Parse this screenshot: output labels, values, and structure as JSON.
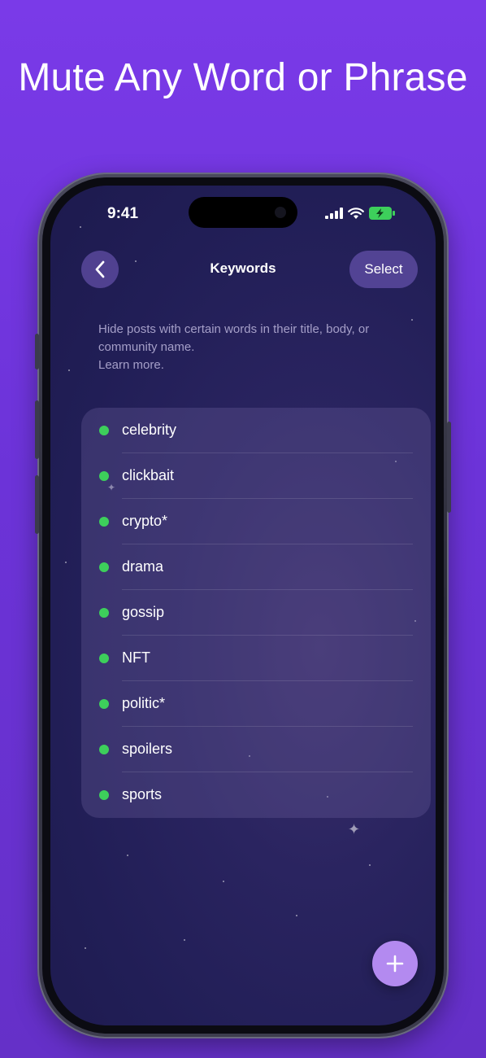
{
  "headline": "Mute Any Word or Phrase",
  "status_bar": {
    "time": "9:41",
    "icons": [
      "signal-icon",
      "wifi-icon",
      "battery-charging-icon"
    ]
  },
  "nav": {
    "title": "Keywords",
    "back_icon": "chevron-left-icon",
    "select_label": "Select"
  },
  "description": {
    "text": "Hide posts with certain words in their title, body, or community name.",
    "link": "Learn more."
  },
  "keywords": [
    {
      "label": "celebrity",
      "active": true
    },
    {
      "label": "clickbait",
      "active": true
    },
    {
      "label": "crypto*",
      "active": true
    },
    {
      "label": "drama",
      "active": true
    },
    {
      "label": "gossip",
      "active": true
    },
    {
      "label": "NFT",
      "active": true
    },
    {
      "label": "politic*",
      "active": true
    },
    {
      "label": "spoilers",
      "active": true
    },
    {
      "label": "sports",
      "active": true
    }
  ],
  "fab_icon": "plus-icon",
  "colors": {
    "background": "#7a3ae8",
    "active_dot": "#3dcf5b",
    "fab": "#b38af0"
  }
}
